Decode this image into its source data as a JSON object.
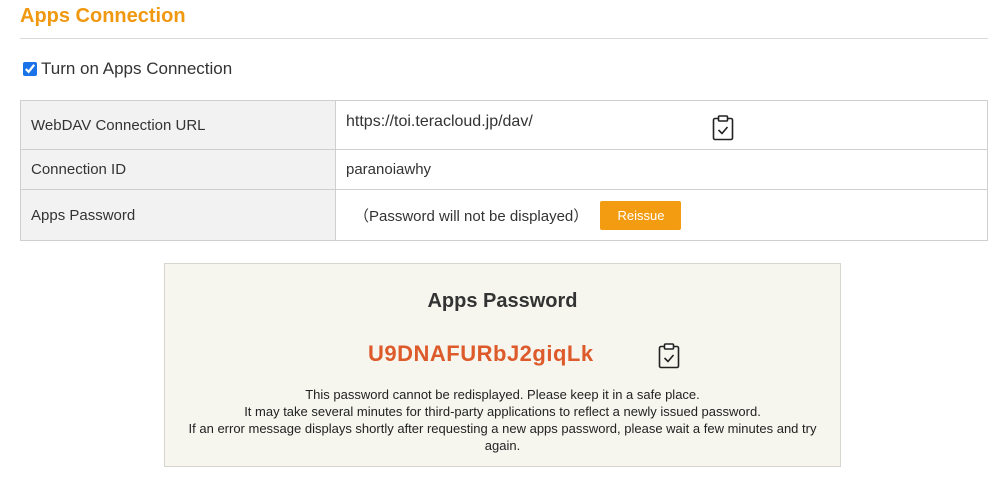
{
  "header": {
    "title": "Apps Connection"
  },
  "toggle": {
    "label": "Turn on Apps Connection",
    "checked": true
  },
  "settings": {
    "rows": [
      {
        "label": "WebDAV Connection URL",
        "value": "https://toi.teracloud.jp/dav/",
        "icon": "clipboard-check-icon"
      },
      {
        "label": "Connection ID",
        "value": "paranoiawhy"
      },
      {
        "label": "Apps Password",
        "value": "（Password will not be displayed）",
        "button": "Reissue"
      }
    ]
  },
  "password_box": {
    "title": "Apps Password",
    "password": "U9DNAFURbJ2giqLk",
    "icon": "clipboard-check-icon",
    "notes": [
      "This password cannot be redisplayed. Please keep it in a safe place.",
      "It may take several minutes for third-party applications to reflect a newly issued password.",
      "If an error message displays shortly after requesting a new apps password, please wait a few minutes and try again."
    ]
  },
  "colors": {
    "accent": "#f0980f",
    "button": "#f39c12",
    "password": "#dd5a2b",
    "box_bg": "#f6f6ef"
  }
}
